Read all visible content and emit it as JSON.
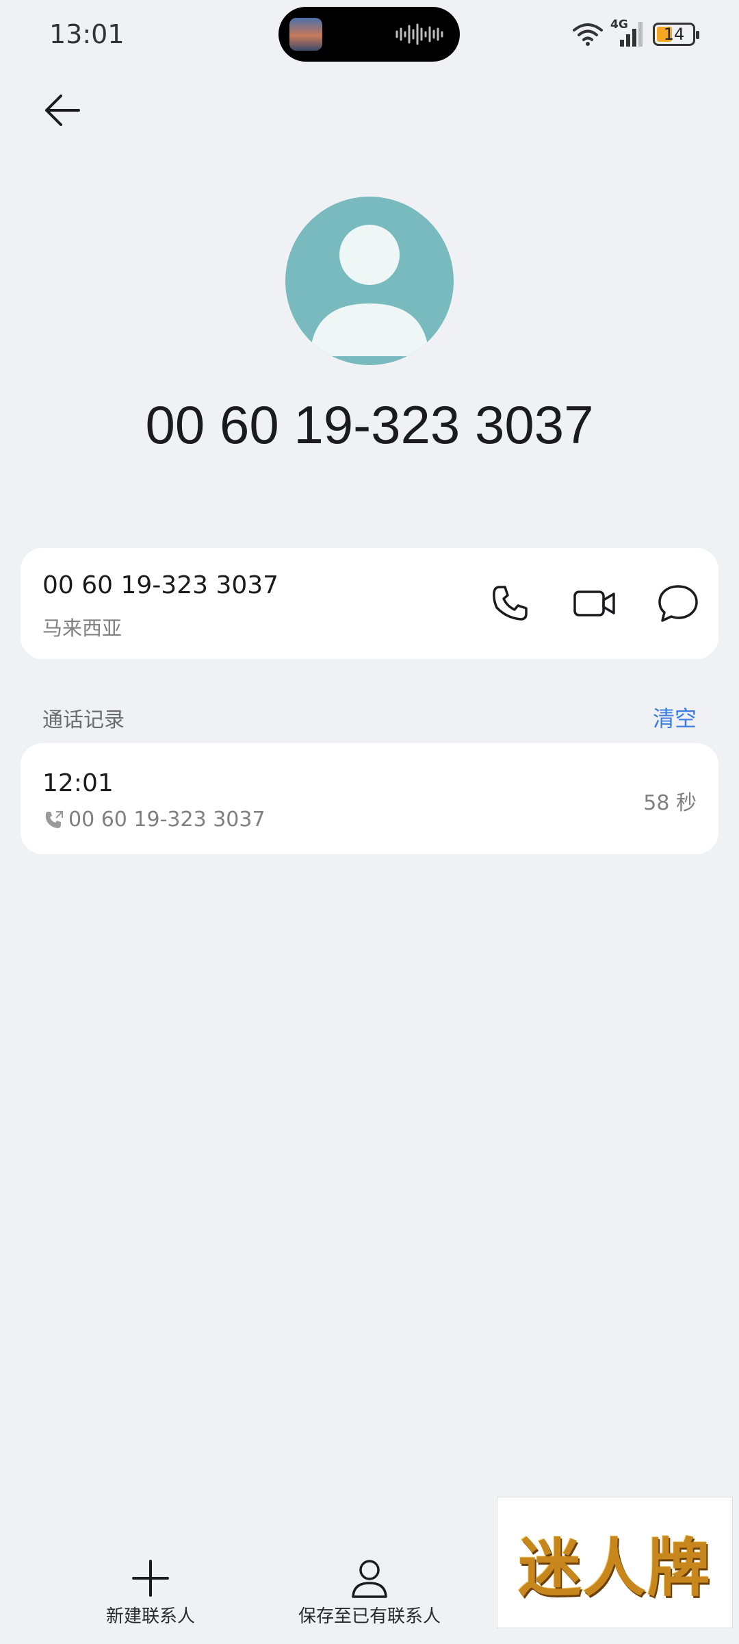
{
  "status_bar": {
    "time": "13:01",
    "network": "4G",
    "battery": "14",
    "battery_color": "#f5a623"
  },
  "header": {
    "back_icon": "arrow-left-icon"
  },
  "contact": {
    "avatar_icon": "person-placeholder-icon",
    "avatar_color": "#78babe",
    "number_display": "00 60 19-323 3037"
  },
  "number_card": {
    "number": "00 60 19-323 3037",
    "region": "马来西亚",
    "actions": [
      {
        "name": "call",
        "icon": "phone-icon"
      },
      {
        "name": "video-call",
        "icon": "video-camera-icon"
      },
      {
        "name": "message",
        "icon": "chat-bubble-icon"
      }
    ]
  },
  "call_log": {
    "title": "通话记录",
    "clear_label": "清空",
    "accent_color": "#3b7de0",
    "entries": [
      {
        "time": "12:01",
        "number": "00 60 19-323 3037",
        "duration": "58 秒",
        "icon": "outgoing-call-icon"
      }
    ]
  },
  "bottom_bar": {
    "new_contact_label": "新建联系人",
    "save_existing_label": "保存至已有联系人"
  },
  "watermark": {
    "text": "迷人牌"
  }
}
